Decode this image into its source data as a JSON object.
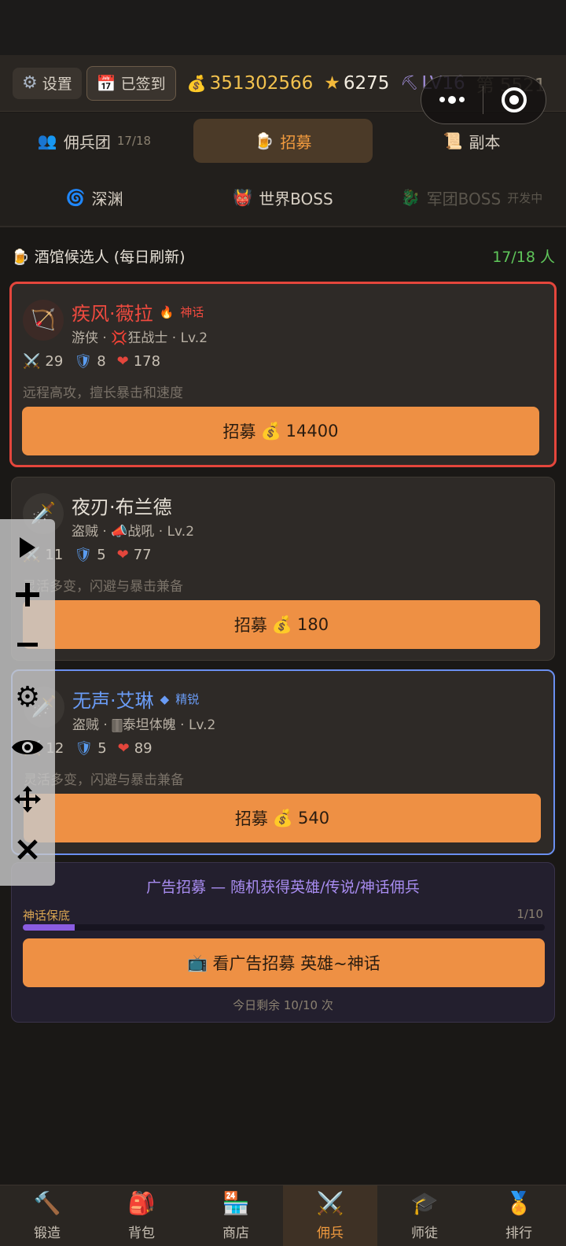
{
  "topbar": {
    "settings_label": "设置",
    "signed_label": "已签到",
    "gold": "351302566",
    "stars": "6275",
    "level": "LV16",
    "rank": "第 5521"
  },
  "nav": {
    "row1": [
      {
        "label": "佣兵团",
        "count": "17/18",
        "icon": "people-icon"
      },
      {
        "label": "招募",
        "icon": "beer-icon"
      },
      {
        "label": "副本",
        "icon": "scroll-icon"
      }
    ],
    "row2": [
      {
        "label": "深渊",
        "icon": "vortex-icon"
      },
      {
        "label": "世界BOSS",
        "icon": "demon-icon"
      },
      {
        "label": "军团BOSS",
        "sub": "开发中",
        "icon": "dragon-icon"
      }
    ]
  },
  "section": {
    "title": "酒馆候选人 (每日刷新)",
    "count": "17/18 人"
  },
  "candidates": [
    {
      "name": "疾风·薇拉",
      "rarity": "神话",
      "cls": "游侠 · 💢狂战士 · Lv.2",
      "atk": "29",
      "def": "8",
      "hp": "178",
      "desc": "远程高攻，擅长暴击和速度",
      "button": "招募",
      "cost": "14400"
    },
    {
      "name": "夜刃·布兰德",
      "rarity": "",
      "cls": "盗贼 · 📣战吼 · Lv.2",
      "atk": "11",
      "def": "5",
      "hp": "77",
      "desc": "灵活多变，闪避与暴击兼备",
      "button": "招募",
      "cost": "180"
    },
    {
      "name": "无声·艾琳",
      "rarity": "精锐",
      "cls": "盗贼 · 🀫泰坦体魄 · Lv.2",
      "atk": "12",
      "def": "5",
      "hp": "89",
      "desc": "灵活多变，闪避与暴击兼备",
      "button": "招募",
      "cost": "540"
    }
  ],
  "ad": {
    "title": "广告招募 — 随机获得英雄/传说/神话佣兵",
    "pity_label": "神话保底",
    "pity_progress": "1/10",
    "pity_fraction": 0.1,
    "button": "看广告招募 英雄~神话",
    "remain": "今日剩余 10/10 次"
  },
  "tabs": [
    {
      "label": "锻造",
      "icon": "hammer-icon"
    },
    {
      "label": "背包",
      "icon": "backpack-icon"
    },
    {
      "label": "商店",
      "icon": "shop-icon"
    },
    {
      "label": "佣兵",
      "icon": "crossed-swords-icon"
    },
    {
      "label": "师徒",
      "icon": "graduation-cap-icon"
    },
    {
      "label": "排行",
      "icon": "medal-icon"
    }
  ],
  "colors": {
    "accent": "#ee9044",
    "mythic": "#e4463c",
    "elite": "#6a8ff0",
    "gold": "#f3c24e",
    "green": "#5fc65a"
  }
}
